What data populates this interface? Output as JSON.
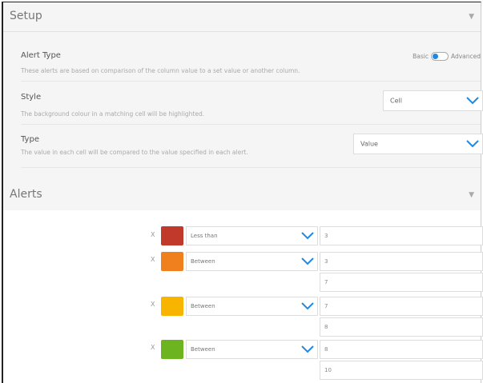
{
  "setup": {
    "title": "Setup",
    "alert_type": {
      "label": "Alert Type",
      "description": "These alerts are based on comparison of the column value to a set value or another column.",
      "toggle_left": "Basic",
      "toggle_right": "Advanced"
    },
    "style": {
      "label": "Style",
      "description": "The background colour in a matching cell will be highlighted.",
      "value": "Cell"
    },
    "type": {
      "label": "Type",
      "description": "The value in each cell will be compared to the value specified in each alert.",
      "value": "Value"
    }
  },
  "alerts": {
    "title": "Alerts",
    "items": [
      {
        "remove": "X",
        "color": "#c0392b",
        "condition": "Less than",
        "values": [
          "3"
        ]
      },
      {
        "remove": "X",
        "color": "#f07f1e",
        "condition": "Between",
        "values": [
          "3",
          "7"
        ]
      },
      {
        "remove": "X",
        "color": "#f7b500",
        "condition": "Between",
        "values": [
          "7",
          "8"
        ]
      },
      {
        "remove": "X",
        "color": "#6cb520",
        "condition": "Between",
        "values": [
          "8",
          "10"
        ]
      }
    ]
  }
}
